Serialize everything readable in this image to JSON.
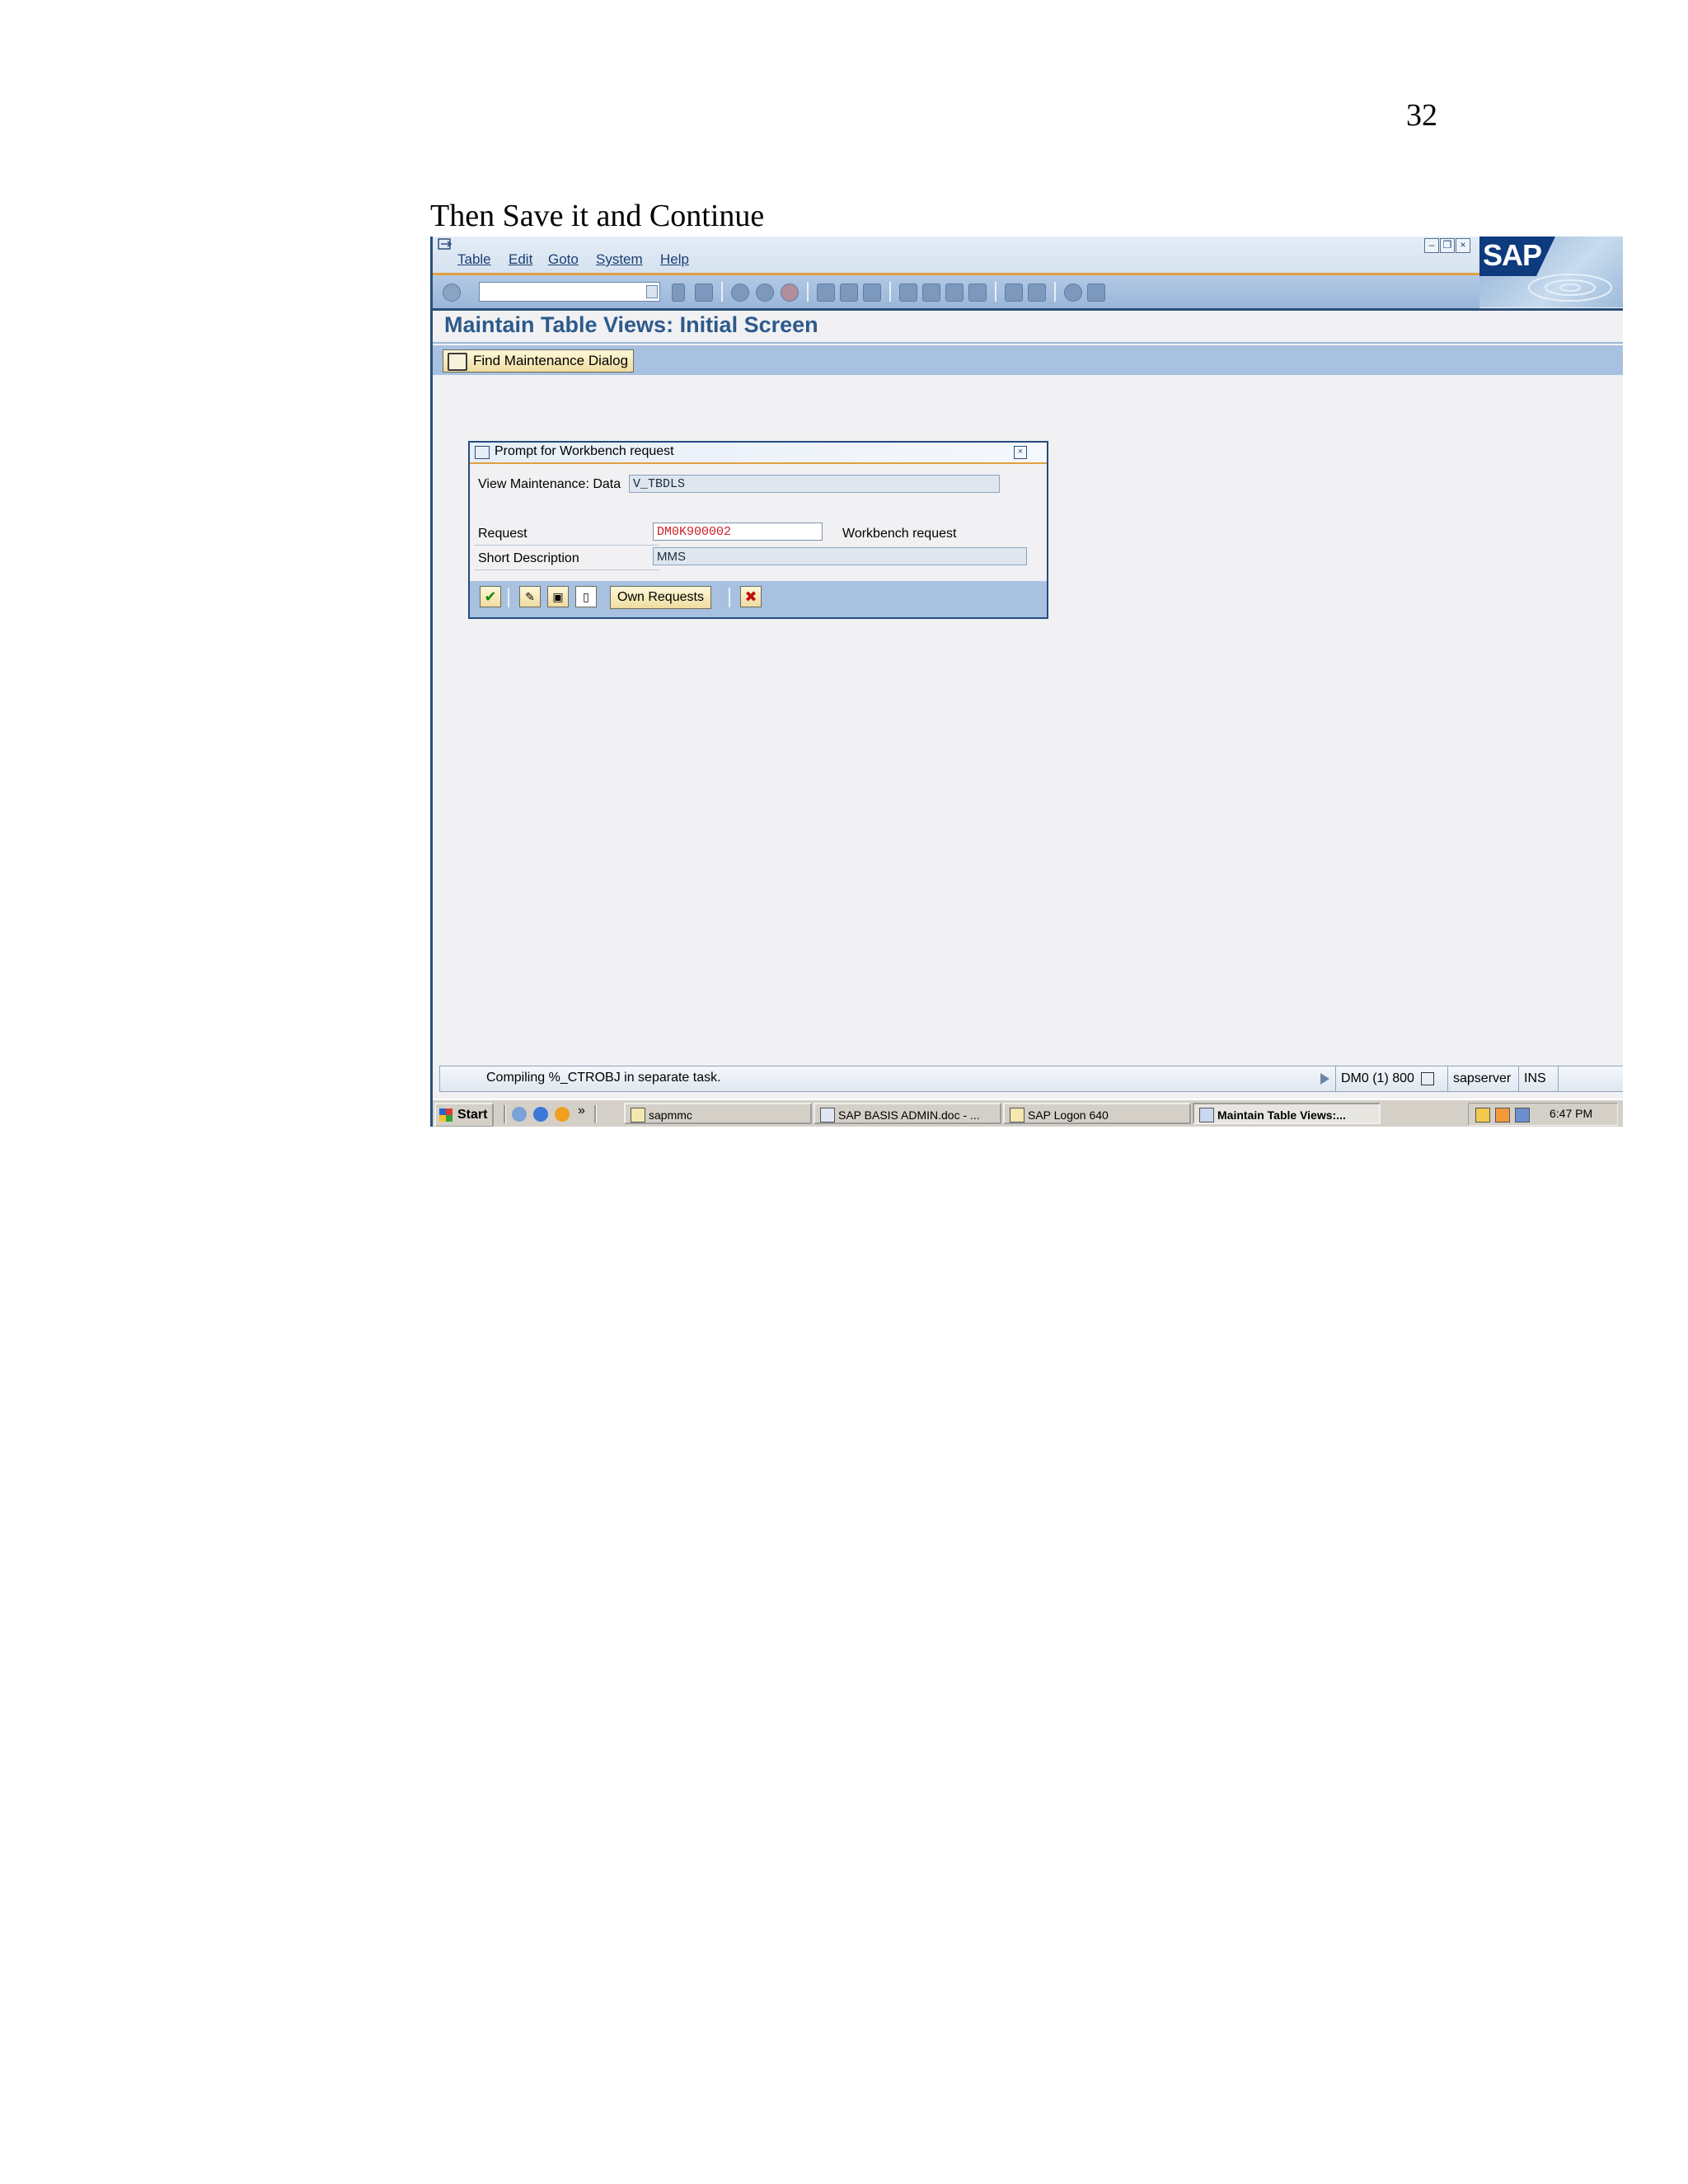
{
  "page_number": "32",
  "caption": "Then Save it and Continue",
  "sap": {
    "menu": [
      "Table",
      "Edit",
      "Goto",
      "System",
      "Help"
    ],
    "logo_text": "SAP",
    "screen_title": "Maintain Table Views: Initial Screen",
    "find_button": "Find Maintenance Dialog",
    "dialog": {
      "title": "Prompt for Workbench request",
      "view_label": "View Maintenance: Data",
      "view_value": "V_TBDLS",
      "request_label": "Request",
      "request_value": "DM0K900002",
      "request_type": "Workbench request",
      "short_desc_label": "Short Description",
      "short_desc_value": "MMS",
      "own_requests_label": "Own Requests"
    },
    "status": {
      "message": "Compiling %_CTROBJ in separate task.",
      "system": "DM0 (1) 800",
      "server": "sapserver",
      "mode": "INS"
    }
  },
  "taskbar": {
    "start_label": "Start",
    "more_label": "»",
    "tasks": [
      {
        "label": "sapmmc",
        "active": false
      },
      {
        "label": "SAP BASIS ADMIN.doc - ...",
        "active": false
      },
      {
        "label": "SAP Logon 640",
        "active": false
      },
      {
        "label": "Maintain Table Views:...",
        "active": true
      }
    ],
    "clock": "6:47 PM"
  },
  "colors": {
    "title_blue": "#2d5a8c",
    "toolbar_blue": "#a8c1e0",
    "request_red": "#d0202a",
    "accent_orange": "#e0a040"
  }
}
